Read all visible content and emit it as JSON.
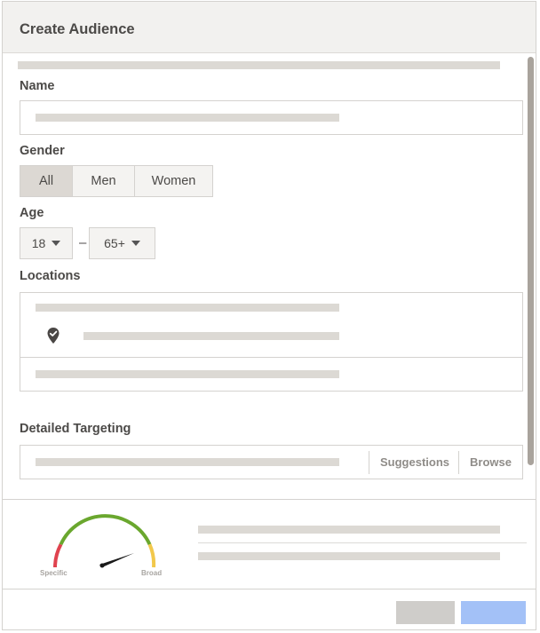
{
  "dialog": {
    "title": "Create Audience"
  },
  "form": {
    "name_label": "Name",
    "gender_label": "Gender",
    "gender_options": [
      "All",
      "Men",
      "Women"
    ],
    "gender_selected": "All",
    "age_label": "Age",
    "age_min": "18",
    "age_separator": "–",
    "age_max": "65+",
    "locations_label": "Locations",
    "detailed_targeting_label": "Detailed Targeting",
    "suggestions_label": "Suggestions",
    "browse_label": "Browse"
  },
  "audience_meter": {
    "specific_label": "Specific",
    "broad_label": "Broad",
    "colors": {
      "low": "#e0434f",
      "mid": "#6aa72e",
      "high": "#f2c84b",
      "needle": "#1a1a1a"
    }
  },
  "footer": {
    "cancel_color": "#cfcdca",
    "confirm_color": "#a3c1f7"
  }
}
